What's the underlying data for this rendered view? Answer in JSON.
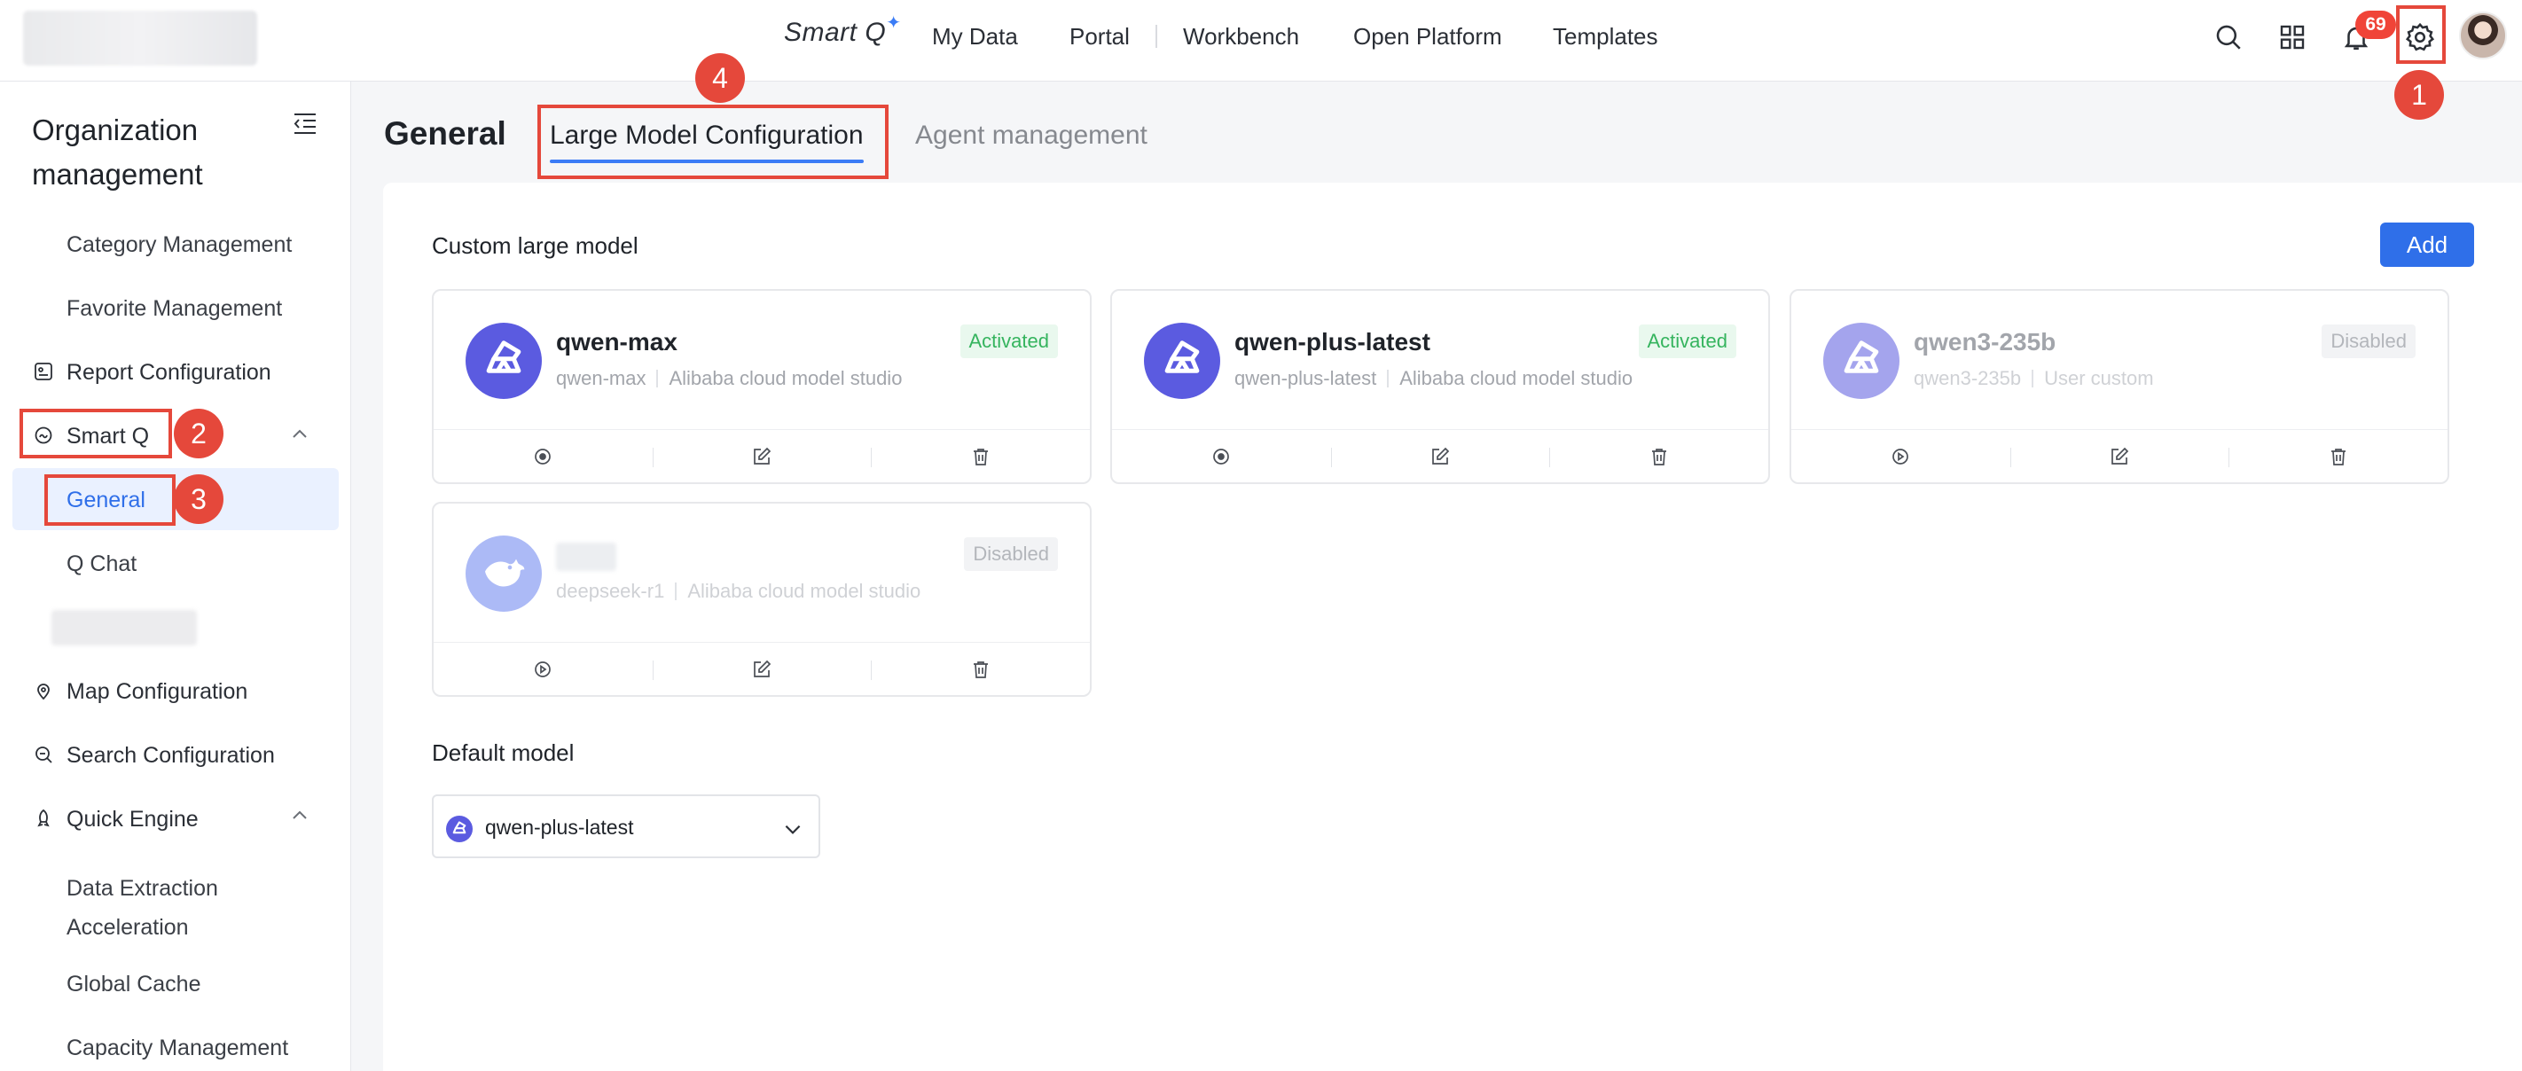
{
  "topbar": {
    "brand": "Smart Q",
    "brand_spark": "✦",
    "nav": [
      "My Data",
      "Portal",
      "Workbench",
      "Open Platform",
      "Templates"
    ],
    "notification_count": "69"
  },
  "sidebar": {
    "title": "Organization management",
    "items": {
      "category_management": "Category Management",
      "favorite_management": "Favorite Management",
      "report_configuration": "Report Configuration",
      "smart_q": "Smart Q",
      "general": "General",
      "q_chat": "Q Chat",
      "map_configuration": "Map Configuration",
      "search_configuration": "Search Configuration",
      "quick_engine": "Quick Engine",
      "data_extraction_acceleration": "Data Extraction Acceleration",
      "global_cache": "Global Cache",
      "capacity_management": "Capacity Management"
    }
  },
  "main": {
    "page_title": "General",
    "tabs": [
      {
        "label": "Large Model Configuration",
        "active": true
      },
      {
        "label": "Agent management",
        "active": false
      }
    ],
    "custom_section_label": "Custom large model",
    "add_button": "Add",
    "models": [
      {
        "name": "qwen-max",
        "id": "qwen-max",
        "provider": "Alibaba cloud model studio",
        "status": "Activated",
        "icon": "qwen-logo-icon"
      },
      {
        "name": "qwen-plus-latest",
        "id": "qwen-plus-latest",
        "provider": "Alibaba cloud model studio",
        "status": "Activated",
        "icon": "qwen-logo-icon"
      },
      {
        "name": "qwen3-235b",
        "id": "qwen3-235b",
        "provider": "User custom",
        "status": "Disabled",
        "icon": "qwen-logo-icon"
      },
      {
        "name": "",
        "id": "deepseek-r1",
        "provider": "Alibaba cloud model studio",
        "status": "Disabled",
        "icon": "deepseek-logo-icon"
      }
    ],
    "default_section_label": "Default model",
    "default_model": "qwen-plus-latest"
  },
  "annotations": [
    "1",
    "2",
    "3",
    "4"
  ],
  "colors": {
    "accent": "#3b7cf6",
    "primary_button": "#2f6fe9",
    "annotation_red": "#e5483b",
    "activated_green": "#35b45e",
    "qwen_purple": "#5b5be0"
  }
}
